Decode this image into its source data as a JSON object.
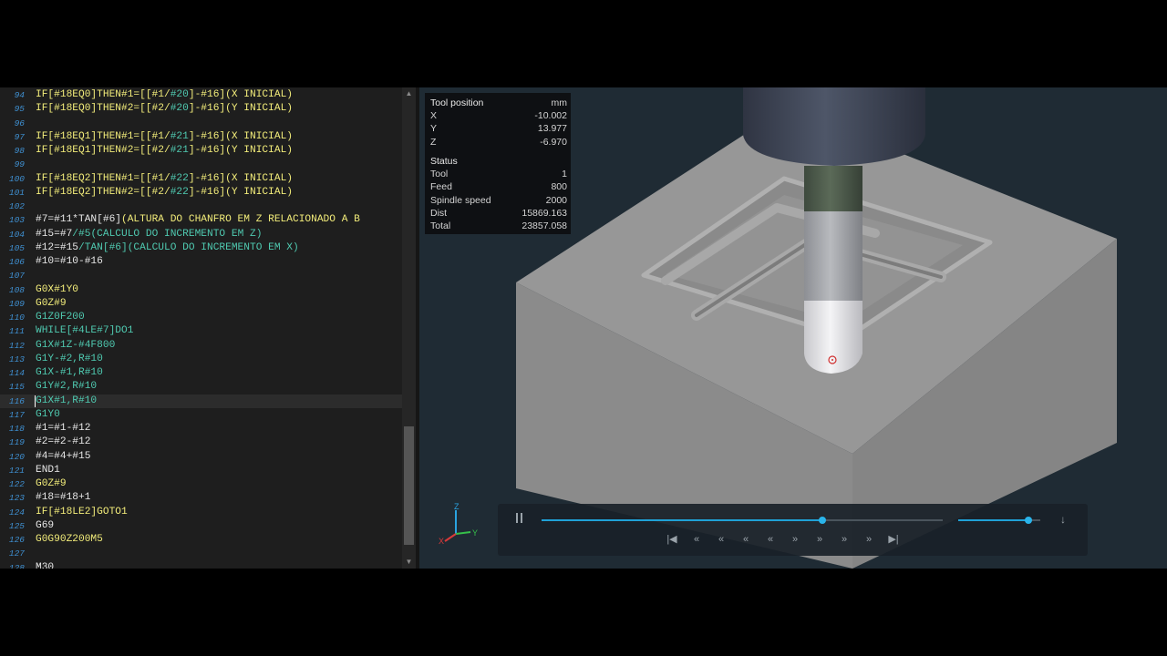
{
  "editor": {
    "lines": [
      {
        "n": "94",
        "segs": [
          {
            "t": "IF[#18EQ0]THEN#1=[[#1/",
            "c": "y"
          },
          {
            "t": "#20",
            "c": "g"
          },
          {
            "t": "]-#16](X INICIAL)",
            "c": "y"
          }
        ]
      },
      {
        "n": "95",
        "segs": [
          {
            "t": "IF[#18EQ0]THEN#2=[[#2/",
            "c": "y"
          },
          {
            "t": "#20",
            "c": "g"
          },
          {
            "t": "]-#16](Y INICIAL)",
            "c": "y"
          }
        ]
      },
      {
        "n": "96",
        "segs": []
      },
      {
        "n": "97",
        "segs": [
          {
            "t": "IF[#18EQ1]THEN#1=[[#1/",
            "c": "y"
          },
          {
            "t": "#21",
            "c": "g"
          },
          {
            "t": "]-#16](X INICIAL)",
            "c": "y"
          }
        ]
      },
      {
        "n": "98",
        "segs": [
          {
            "t": "IF[#18EQ1]THEN#2=[[#2/",
            "c": "y"
          },
          {
            "t": "#21",
            "c": "g"
          },
          {
            "t": "]-#16](Y INICIAL)",
            "c": "y"
          }
        ]
      },
      {
        "n": "99",
        "segs": []
      },
      {
        "n": "100",
        "segs": [
          {
            "t": "IF[#18EQ2]THEN#1=[[#1/",
            "c": "y"
          },
          {
            "t": "#22",
            "c": "g"
          },
          {
            "t": "]-#16](X INICIAL)",
            "c": "y"
          }
        ]
      },
      {
        "n": "101",
        "segs": [
          {
            "t": "IF[#18EQ2]THEN#2=[[#2/",
            "c": "y"
          },
          {
            "t": "#22",
            "c": "g"
          },
          {
            "t": "]-#16](Y INICIAL)",
            "c": "y"
          }
        ]
      },
      {
        "n": "102",
        "segs": []
      },
      {
        "n": "103",
        "segs": [
          {
            "t": "#7=#11*TAN[#6]",
            "c": "d"
          },
          {
            "t": "(ALTURA DO CHANFRO EM Z RELACIONADO A B",
            "c": "y"
          }
        ]
      },
      {
        "n": "104",
        "segs": [
          {
            "t": "#15=#7",
            "c": "d"
          },
          {
            "t": "/#5(CALCULO DO INCREMENTO EM Z)",
            "c": "g"
          }
        ]
      },
      {
        "n": "105",
        "segs": [
          {
            "t": "#12=#15",
            "c": "d"
          },
          {
            "t": "/TAN[#6](CALCULO DO INCREMENTO EM X)",
            "c": "g"
          }
        ]
      },
      {
        "n": "106",
        "segs": [
          {
            "t": "#10=#10-#16",
            "c": "d"
          }
        ]
      },
      {
        "n": "107",
        "segs": []
      },
      {
        "n": "108",
        "segs": [
          {
            "t": "G0X#1Y0",
            "c": "y"
          }
        ]
      },
      {
        "n": "109",
        "segs": [
          {
            "t": "G0Z#9",
            "c": "y"
          }
        ]
      },
      {
        "n": "110",
        "segs": [
          {
            "t": "G1Z0F200",
            "c": "g"
          }
        ]
      },
      {
        "n": "111",
        "segs": [
          {
            "t": "WHILE[#4LE#7]DO1",
            "c": "g"
          }
        ]
      },
      {
        "n": "112",
        "segs": [
          {
            "t": "G1X#1Z-#4F800",
            "c": "g"
          }
        ]
      },
      {
        "n": "113",
        "segs": [
          {
            "t": "G1Y-#2,R#10",
            "c": "g"
          }
        ]
      },
      {
        "n": "114",
        "segs": [
          {
            "t": "G1X-#1,R#10",
            "c": "g"
          }
        ]
      },
      {
        "n": "115",
        "segs": [
          {
            "t": "G1Y#2,R#10",
            "c": "g"
          }
        ]
      },
      {
        "n": "116",
        "segs": [
          {
            "t": "G1X#1,R#10",
            "c": "g"
          }
        ]
      },
      {
        "n": "117",
        "segs": [
          {
            "t": "G1Y0",
            "c": "g"
          }
        ]
      },
      {
        "n": "118",
        "segs": [
          {
            "t": "#1=#1-#12",
            "c": "d"
          }
        ]
      },
      {
        "n": "119",
        "segs": [
          {
            "t": "#2=#2-#12",
            "c": "d"
          }
        ]
      },
      {
        "n": "120",
        "segs": [
          {
            "t": "#4=#4+#15",
            "c": "d"
          }
        ]
      },
      {
        "n": "121",
        "segs": [
          {
            "t": "END1",
            "c": "d"
          }
        ]
      },
      {
        "n": "122",
        "segs": [
          {
            "t": "G0Z#9",
            "c": "y"
          }
        ]
      },
      {
        "n": "123",
        "segs": [
          {
            "t": "#18=#18+1",
            "c": "d"
          }
        ]
      },
      {
        "n": "124",
        "segs": [
          {
            "t": "IF[#18LE2]GOTO1",
            "c": "y"
          }
        ]
      },
      {
        "n": "125",
        "segs": [
          {
            "t": "G69",
            "c": "d"
          }
        ]
      },
      {
        "n": "126",
        "segs": [
          {
            "t": "G0G90Z200M5",
            "c": "y"
          }
        ]
      },
      {
        "n": "127",
        "segs": []
      },
      {
        "n": "128",
        "segs": [
          {
            "t": "M30",
            "c": "d"
          }
        ]
      }
    ],
    "current_line": "116"
  },
  "colors": {
    "y": "#f2ec7a",
    "g": "#4fc9b0",
    "d": "#e6e6e6"
  },
  "tool_position": {
    "title": "Tool position",
    "unit": "mm",
    "x_label": "X",
    "x": "-10.002",
    "y_label": "Y",
    "y": "13.977",
    "z_label": "Z",
    "z": "-6.970"
  },
  "status": {
    "title": "Status",
    "tool_label": "Tool",
    "tool": "1",
    "feed_label": "Feed",
    "feed": "800",
    "spindle_label": "Spindle speed",
    "spindle": "2000",
    "dist_label": "Dist",
    "dist": "15869.163",
    "total_label": "Total",
    "total": "23857.058"
  },
  "playback": {
    "progress": 0.7,
    "speed": 0.85
  },
  "axis": {
    "x": "X",
    "y": "Y",
    "z": "Z"
  }
}
